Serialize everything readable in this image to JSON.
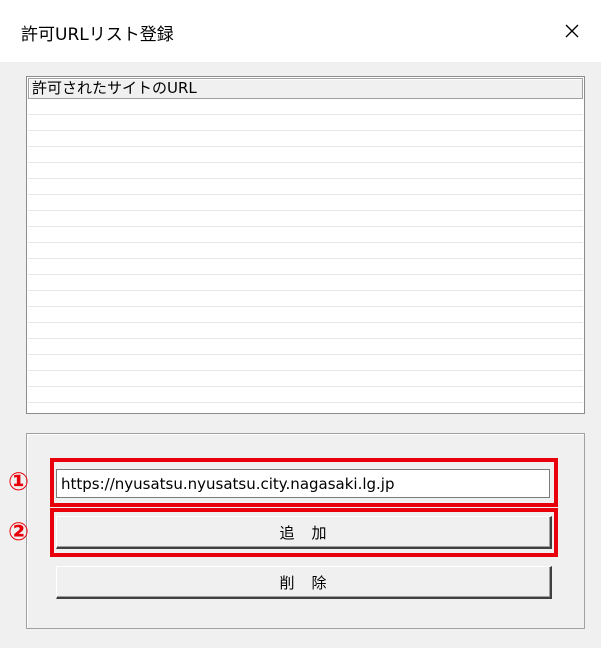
{
  "window": {
    "title": "許可URLリスト登録",
    "close_symbol": "×"
  },
  "list": {
    "header": "許可されたサイトのURL",
    "items": []
  },
  "form": {
    "url_value": "https://nyusatsu.nyusatsu.city.nagasaki.lg.jp",
    "add_label": "追　加",
    "delete_label": "削　除"
  },
  "annotations": {
    "marker1": "①",
    "marker2": "②",
    "color": "#e8000b"
  }
}
